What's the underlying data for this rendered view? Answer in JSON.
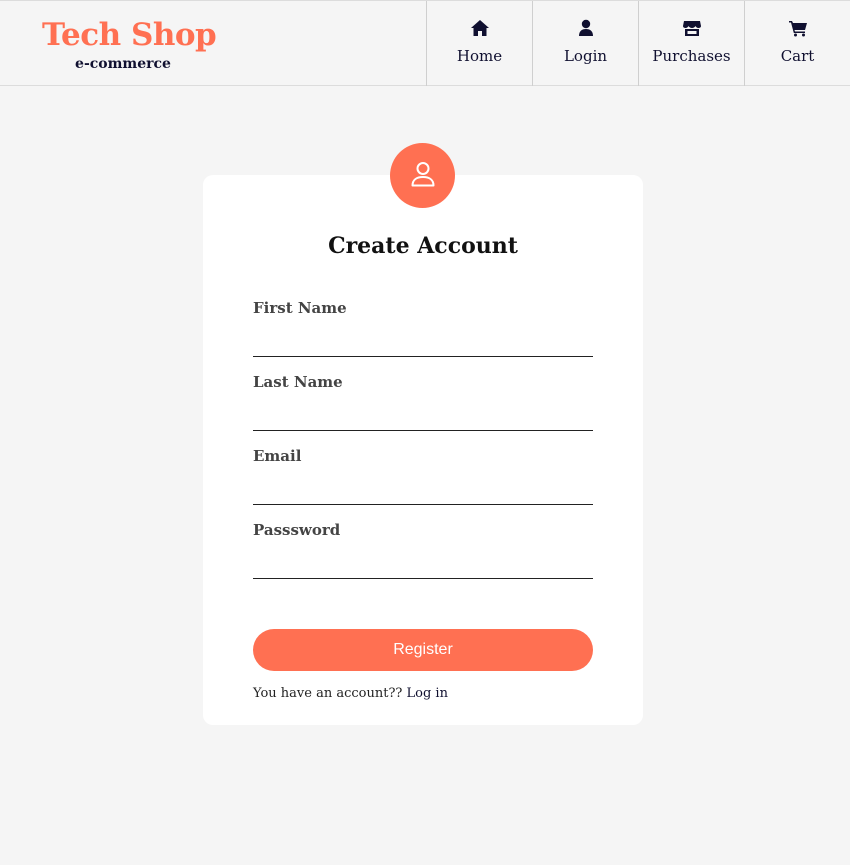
{
  "brand": {
    "title": "Tech Shop",
    "subtitle": "e-commerce",
    "color": "#ff7052"
  },
  "nav": {
    "items": [
      {
        "label": "Home",
        "icon": "home-icon"
      },
      {
        "label": "Login",
        "icon": "user-icon"
      },
      {
        "label": "Purchases",
        "icon": "store-icon"
      },
      {
        "label": "Cart",
        "icon": "cart-icon"
      }
    ]
  },
  "form": {
    "avatar_icon": "user-outline-icon",
    "title": "Create Account",
    "fields": [
      {
        "label": "First Name",
        "value": ""
      },
      {
        "label": "Last Name",
        "value": ""
      },
      {
        "label": "Email",
        "value": ""
      },
      {
        "label": "Passsword",
        "value": ""
      }
    ],
    "register_label": "Register",
    "login_prompt": "You have an account?? ",
    "login_link": "Log in"
  },
  "colors": {
    "accent": "#ff7052",
    "nav_text": "#101030",
    "background": "#f5f5f5",
    "card": "#ffffff"
  }
}
